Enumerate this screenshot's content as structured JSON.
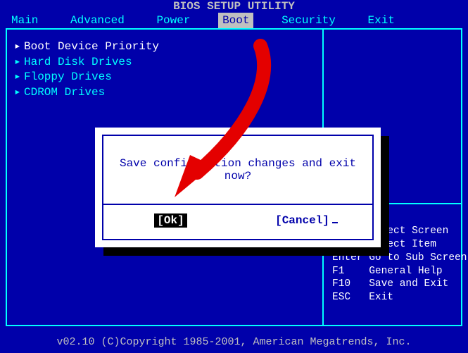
{
  "title": "BIOS SETUP UTILITY",
  "menu": [
    {
      "label": "Main",
      "selected": false
    },
    {
      "label": "Advanced",
      "selected": false
    },
    {
      "label": "Power",
      "selected": false
    },
    {
      "label": "Boot",
      "selected": true
    },
    {
      "label": "Security",
      "selected": false
    },
    {
      "label": "Exit",
      "selected": false
    }
  ],
  "boot_list": [
    {
      "label": "Boot Device Priority",
      "selected": true
    },
    {
      "label": "Hard Disk Drives",
      "selected": false
    },
    {
      "label": "Floppy Drives",
      "selected": false
    },
    {
      "label": "CDROM Drives",
      "selected": false
    }
  ],
  "help": {
    "l1": "←→    Select Screen",
    "l2": "↑↓    Select Item",
    "l3": "Enter Go to Sub Screen",
    "l4": "F1    General Help",
    "l5": "F10   Save and Exit",
    "l6": "ESC   Exit"
  },
  "dialog": {
    "message": "Save configuration changes and exit now?",
    "ok": "[Ok]",
    "cancel": "[Cancel]"
  },
  "footer": "v02.10 (C)Copyright 1985-2001, American Megatrends, Inc."
}
